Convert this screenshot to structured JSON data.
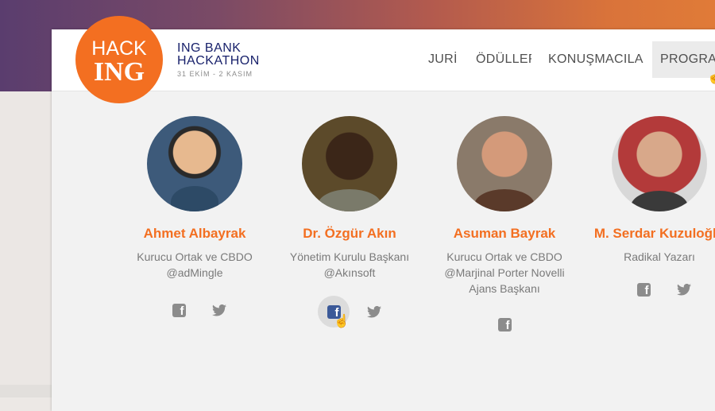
{
  "header": {
    "logo_line1": "HACK",
    "logo_line2": "ING",
    "brand_line1": "ING BANK",
    "brand_line2": "HACKATHON",
    "date": "31 EKİM - 2 KASIM"
  },
  "nav": {
    "items": [
      {
        "label": "JURİ"
      },
      {
        "label": "ÖDÜLLER"
      },
      {
        "label": "KONUŞMACILAR"
      },
      {
        "label": "PROGRAM"
      }
    ],
    "active_index": 3
  },
  "speakers": [
    {
      "name": "Ahmet Albayrak",
      "role_line1": "Kurucu Ortak ve CBDO",
      "role_line2": "@adMingle",
      "role_line3": "",
      "socials": [
        "facebook-icon",
        "twitter-icon"
      ]
    },
    {
      "name": "Dr. Özgür Akın",
      "role_line1": "Yönetim Kurulu Başkanı",
      "role_line2": "@Akınsoft",
      "role_line3": "",
      "socials": [
        "facebook-icon",
        "twitter-icon"
      ]
    },
    {
      "name": "Asuman Bayrak",
      "role_line1": "Kurucu Ortak ve CBDO",
      "role_line2": "@Marjinal Porter Novelli",
      "role_line3": "Ajans Başkanı",
      "socials": [
        "facebook-icon"
      ]
    },
    {
      "name": "M. Serdar Kuzuloğlu",
      "role_line1": "Radikal Yazarı",
      "role_line2": "",
      "role_line3": "",
      "socials": [
        "facebook-icon",
        "twitter-icon"
      ]
    }
  ],
  "colors": {
    "brand_orange": "#f36f21",
    "brand_navy": "#18216b",
    "facebook_blue": "#3b5998"
  }
}
